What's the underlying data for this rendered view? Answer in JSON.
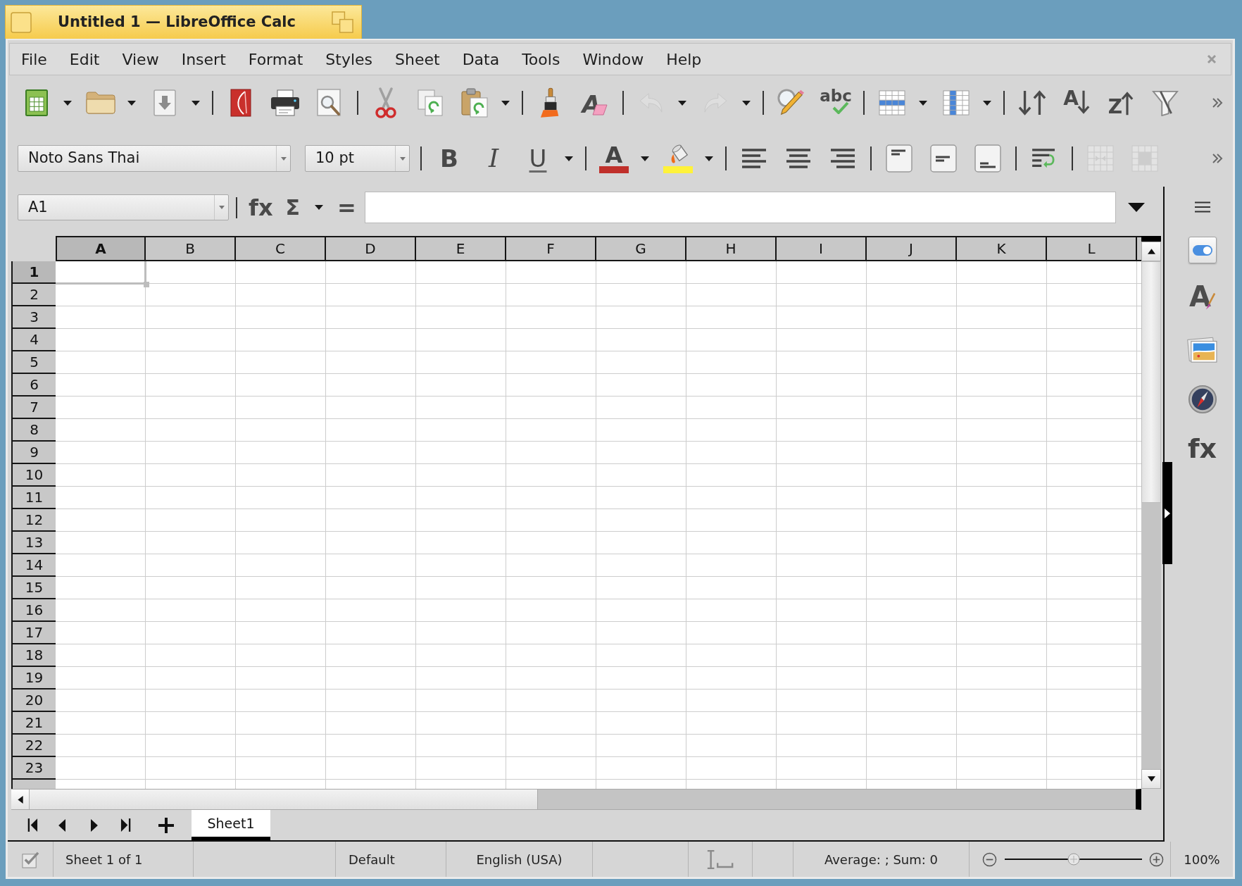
{
  "window": {
    "title": "Untitled 1 — LibreOffice Calc"
  },
  "menu_bar": [
    "File",
    "Edit",
    "View",
    "Insert",
    "Format",
    "Styles",
    "Sheet",
    "Data",
    "Tools",
    "Window",
    "Help"
  ],
  "standard_toolbar": {
    "clear_formatting": {
      "glyph": "A"
    },
    "undo": {
      "disabled": true
    },
    "redo": {
      "disabled": true
    },
    "spelling": {
      "glyph": "abc"
    },
    "sort_ascending": {
      "glyph": "A"
    },
    "sort_descending": {
      "glyph": "Z"
    }
  },
  "formatting_toolbar": {
    "font_name": "Noto Sans Thai",
    "font_size": "10 pt",
    "bold": "B",
    "italic": "I",
    "underline": "U",
    "font_color": {
      "glyph": "A",
      "color": "#c0302b"
    },
    "highlighting": {
      "color": "#fff23a"
    },
    "merge_and_center": {
      "disabled": true
    },
    "merge_cells": {
      "disabled": true
    }
  },
  "formula_bar": {
    "name_box": "A1",
    "function_wizard": "fx",
    "sum": "Σ",
    "equals": "="
  },
  "columns": [
    {
      "label": "A",
      "selected": true
    },
    {
      "label": "B",
      "selected": false
    },
    {
      "label": "C",
      "selected": false
    },
    {
      "label": "D",
      "selected": false
    },
    {
      "label": "E",
      "selected": false
    },
    {
      "label": "F",
      "selected": false
    },
    {
      "label": "G",
      "selected": false
    },
    {
      "label": "H",
      "selected": false
    },
    {
      "label": "I",
      "selected": false
    },
    {
      "label": "J",
      "selected": false
    },
    {
      "label": "K",
      "selected": false
    },
    {
      "label": "L",
      "selected": false
    }
  ],
  "rows": [
    {
      "label": "1",
      "selected": true
    },
    {
      "label": "2",
      "selected": false
    },
    {
      "label": "3",
      "selected": false
    },
    {
      "label": "4",
      "selected": false
    },
    {
      "label": "5",
      "selected": false
    },
    {
      "label": "6",
      "selected": false
    },
    {
      "label": "7",
      "selected": false
    },
    {
      "label": "8",
      "selected": false
    },
    {
      "label": "9",
      "selected": false
    },
    {
      "label": "10",
      "selected": false
    },
    {
      "label": "11",
      "selected": false
    },
    {
      "label": "12",
      "selected": false
    },
    {
      "label": "13",
      "selected": false
    },
    {
      "label": "14",
      "selected": false
    },
    {
      "label": "15",
      "selected": false
    },
    {
      "label": "16",
      "selected": false
    },
    {
      "label": "17",
      "selected": false
    },
    {
      "label": "18",
      "selected": false
    },
    {
      "label": "19",
      "selected": false
    },
    {
      "label": "20",
      "selected": false
    },
    {
      "label": "21",
      "selected": false
    },
    {
      "label": "22",
      "selected": false
    },
    {
      "label": "23",
      "selected": false
    }
  ],
  "sheet_tabs": [
    {
      "label": "Sheet1",
      "selected": true
    }
  ],
  "sidebar": {
    "tabs": [
      {
        "kind": "properties",
        "selected": true
      },
      {
        "kind": "styles",
        "glyph": "A",
        "selected": false
      },
      {
        "kind": "gallery",
        "selected": false
      },
      {
        "kind": "navigator",
        "selected": false
      },
      {
        "kind": "functions",
        "glyph": "fx",
        "selected": false
      }
    ]
  },
  "status_bar": {
    "sheet_position": "Sheet 1 of 1",
    "page_style": "Default",
    "language": "English (USA)",
    "selection_summary": "Average: ; Sum: 0",
    "zoom": {
      "level": 0.5,
      "reading": "100%"
    }
  }
}
